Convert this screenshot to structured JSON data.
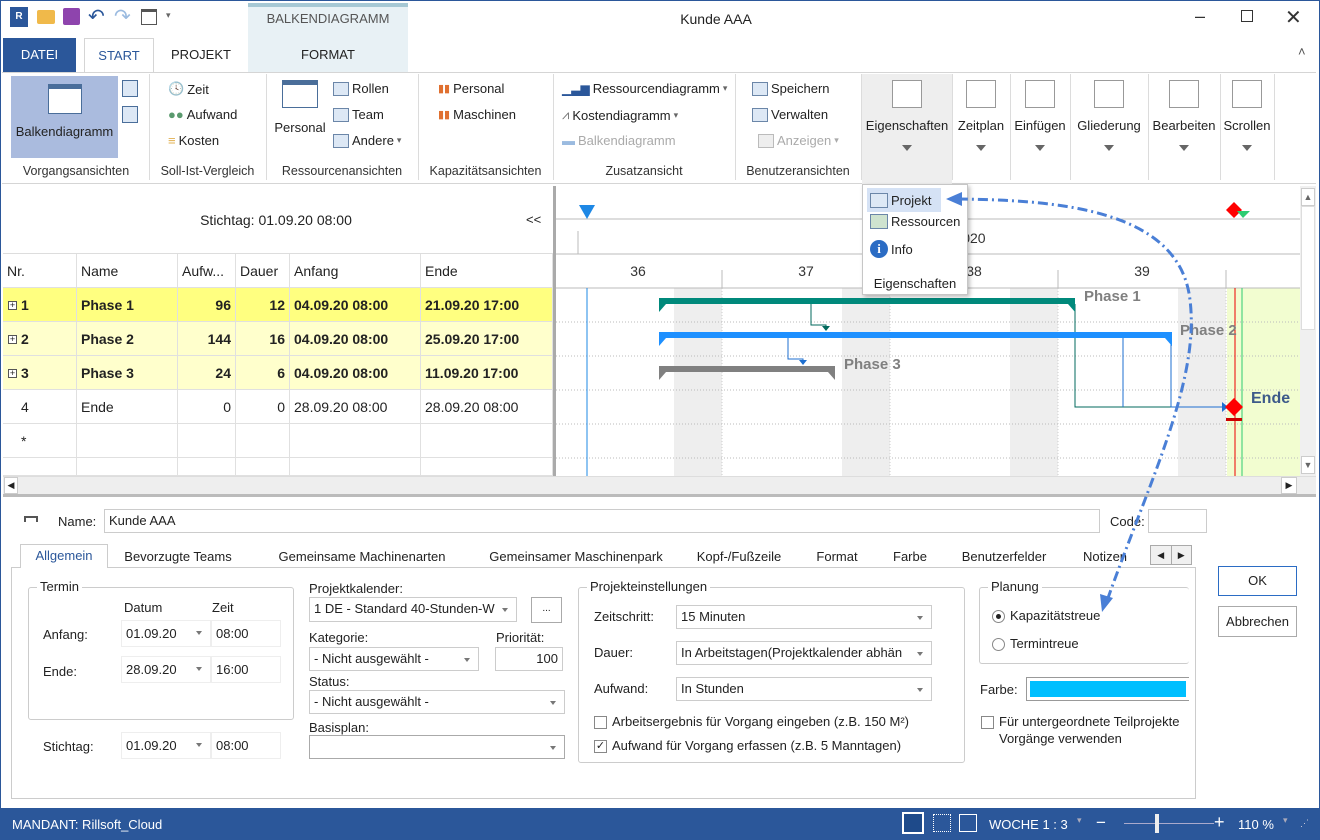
{
  "window": {
    "title": "Kunde AAA",
    "context_tab_group": "BALKENDIAGRAMM",
    "controls": [
      "minimize",
      "maximize",
      "close"
    ]
  },
  "tabs": [
    {
      "label": "DATEI"
    },
    {
      "label": "START",
      "active": true
    },
    {
      "label": "PROJEKT"
    },
    {
      "label": "FORMAT"
    }
  ],
  "ribbon": {
    "vorgang": {
      "label": "Vorgangsansichten",
      "big": "Balkendiagramm"
    },
    "soll": {
      "label": "Soll-Ist-Vergleich",
      "items": [
        "Zeit",
        "Aufwand",
        "Kosten"
      ]
    },
    "ress": {
      "label": "Ressourcenansichten",
      "big": "Personal",
      "items": [
        "Rollen",
        "Team",
        "Andere"
      ]
    },
    "kap": {
      "label": "Kapazitätsansichten",
      "items": [
        "Personal",
        "Maschinen"
      ]
    },
    "zusatz": {
      "label": "Zusatzansicht",
      "items": [
        "Ressourcendiagramm",
        "Kostendiagramm",
        "Balkendiagramm"
      ]
    },
    "benutzer": {
      "label": "Benutzeransichten",
      "items": [
        "Speichern",
        "Verwalten",
        "Anzeigen"
      ]
    },
    "big_buttons": [
      "Eigenschaften",
      "Zeitplan",
      "Einfügen",
      "Gliederung",
      "Bearbeiten",
      "Scrollen"
    ]
  },
  "dropdown": {
    "items": [
      "Projekt",
      "Ressourcen",
      "Info"
    ],
    "footer": "Eigenschaften"
  },
  "gantt": {
    "stichtag": "Stichtag: 01.09.20 08:00",
    "collapse": "<<",
    "columns": [
      "Nr.",
      "Name",
      "Aufw...",
      "Dauer",
      "Anfang",
      "Ende"
    ],
    "rows": [
      {
        "nr": "1",
        "name": "Phase 1",
        "aufw": "96",
        "dauer": "12",
        "anfang": "04.09.20 08:00",
        "ende": "21.09.20 17:00"
      },
      {
        "nr": "2",
        "name": "Phase 2",
        "aufw": "144",
        "dauer": "16",
        "anfang": "04.09.20 08:00",
        "ende": "25.09.20 17:00"
      },
      {
        "nr": "3",
        "name": "Phase 3",
        "aufw": "24",
        "dauer": "6",
        "anfang": "04.09.20 08:00",
        "ende": "11.09.20 17:00"
      },
      {
        "nr": "4",
        "name": "Ende",
        "aufw": "0",
        "dauer": "0",
        "anfang": "28.09.20 08:00",
        "ende": "28.09.20 08:00"
      }
    ],
    "new_row": "*",
    "year": "2020",
    "weeks": [
      "36",
      "37",
      "38",
      "39"
    ],
    "bar_labels": [
      "Phase 1",
      "Phase 2",
      "Phase 3",
      "Ende"
    ],
    "colors": {
      "phase1": "#00897b",
      "phase2": "#1e90ff",
      "phase3": "#808080",
      "milestone": "#ff0000"
    }
  },
  "details": {
    "name_label": "Name:",
    "name_value": "Kunde AAA",
    "code_label": "Code:",
    "code_value": "",
    "tabs": [
      "Allgemein",
      "Bevorzugte Teams",
      "Gemeinsame Machinenarten",
      "Gemeinsamer Maschinenpark",
      "Kopf-/Fußzeile",
      "Format",
      "Farbe",
      "Benutzerfelder",
      "Notizen"
    ],
    "termin": {
      "title": "Termin",
      "datum": "Datum",
      "zeit": "Zeit",
      "anfang_label": "Anfang:",
      "anfang_date": "01.09.20",
      "anfang_time": "08:00",
      "ende_label": "Ende:",
      "ende_date": "28.09.20",
      "ende_time": "16:00"
    },
    "stichtag": {
      "label": "Stichtag:",
      "date": "01.09.20",
      "time": "08:00"
    },
    "kalender_label": "Projektkalender:",
    "kalender_value": "1 DE - Standard 40-Stunden-W",
    "more": "...",
    "kategorie_label": "Kategorie:",
    "kategorie_value": "- Nicht ausgewählt -",
    "prioritaet_label": "Priorität:",
    "prioritaet_value": "100",
    "status_label": "Status:",
    "status_value": "- Nicht ausgewählt -",
    "basisplan_label": "Basisplan:",
    "basisplan_value": "",
    "pe": {
      "title": "Projekteinstellungen",
      "zeitschritt_label": "Zeitschritt:",
      "zeitschritt": "15 Minuten",
      "dauer_label": "Dauer:",
      "dauer": "In Arbeitstagen(Projektkalender abhän",
      "aufwand_label": "Aufwand:",
      "aufwand": "In Stunden",
      "cb1": "Arbeitsergebnis für Vorgang eingeben (z.B. 150 M²)",
      "cb1_checked": false,
      "cb2": "Aufwand für Vorgang erfassen (z.B. 5 Manntagen)",
      "cb2_checked": true
    },
    "planung": {
      "title": "Planung",
      "opt1": "Kapazitätstreue",
      "opt2": "Termintreue",
      "selected": "Kapazitätstreue"
    },
    "farbe_label": "Farbe:",
    "farbe_color": "#00bfff",
    "teil_cb": "Für untergeordnete Teilprojekte",
    "teil_cb2": "Vorgänge verwenden",
    "teil_checked": false,
    "ok": "OK",
    "cancel": "Abbrechen"
  },
  "status": {
    "mandant": "MANDANT: Rillsoft_Cloud",
    "scale": "WOCHE 1 : 3",
    "zoom": "110 %",
    "zoom_minus": "−",
    "zoom_plus": "+",
    "zoom_level_percent": 110
  }
}
